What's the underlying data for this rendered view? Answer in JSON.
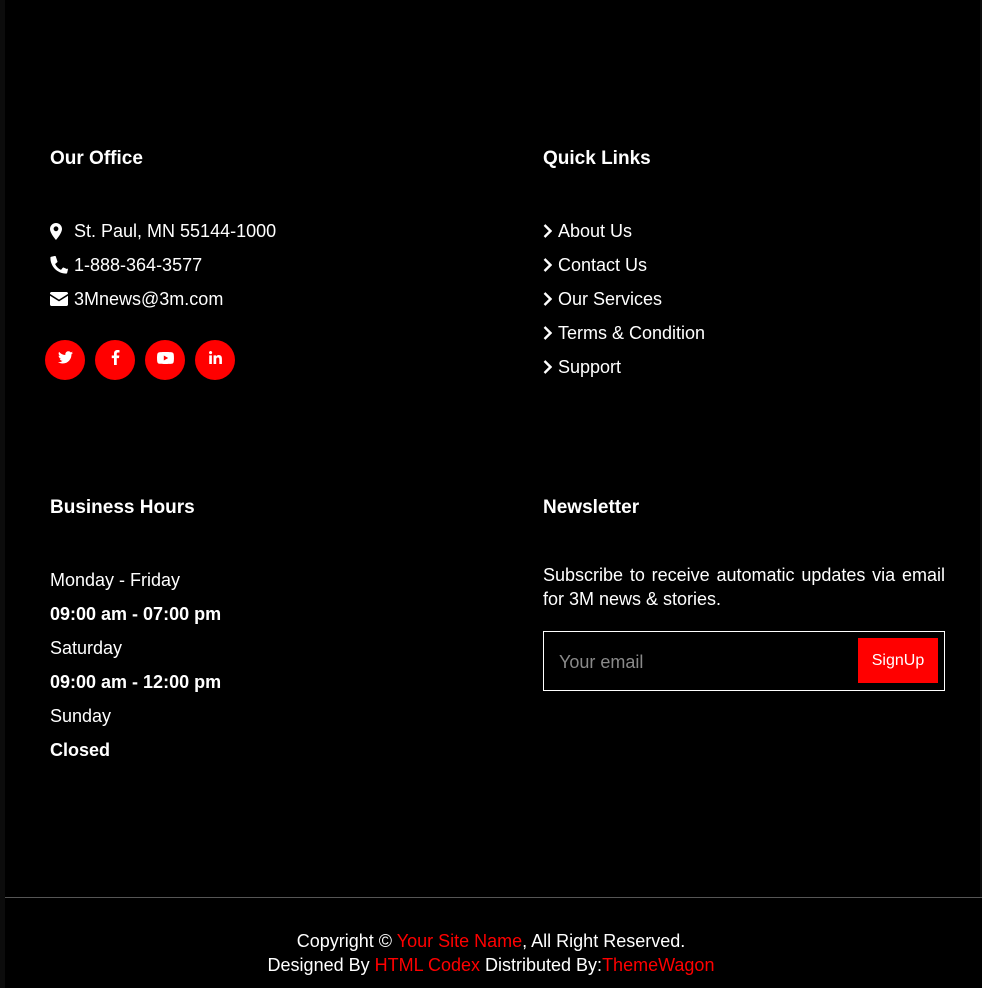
{
  "office": {
    "title": "Our Office",
    "address": "St. Paul, MN 55144-1000",
    "phone": "1-888-364-3577",
    "email": "3Mnews@3m.com",
    "social": [
      "twitter-icon",
      "facebook-icon",
      "youtube-icon",
      "linkedin-icon"
    ]
  },
  "quick_links": {
    "title": "Quick Links",
    "items": [
      {
        "label": "About Us"
      },
      {
        "label": "Contact Us"
      },
      {
        "label": "Our Services"
      },
      {
        "label": "Terms & Condition"
      },
      {
        "label": "Support"
      }
    ]
  },
  "hours": {
    "title": "Business Hours",
    "rows": [
      {
        "label": "Monday - Friday"
      },
      {
        "label": "09:00 am - 07:00 pm"
      },
      {
        "label": "Saturday"
      },
      {
        "label": "09:00 am - 12:00 pm"
      },
      {
        "label": "Sunday"
      },
      {
        "label": "Closed"
      }
    ]
  },
  "newsletter": {
    "title": "Newsletter",
    "description": "Subscribe to receive automatic updates via email for 3M news & stories.",
    "email_placeholder": "Your email",
    "signup_label": "SignUp"
  },
  "footer": {
    "copyright_prefix": "Copyright ©",
    "site_name": "Your Site Name",
    "rights_suffix": ", All Right Reserved.",
    "designed_by": "Designed By",
    "designer": "HTML Codex",
    "distributed_by": "Distributed By:",
    "distributor": "ThemeWagon"
  },
  "colors": {
    "background": "#000000",
    "accent": "#ff0000",
    "text": "#ffffff"
  }
}
